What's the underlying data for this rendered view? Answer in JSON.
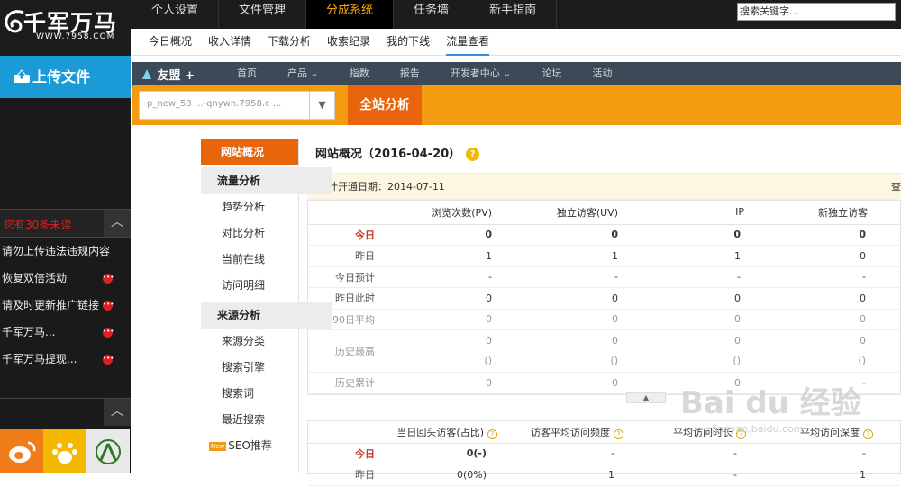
{
  "brand": {
    "name": "千军万马",
    "url": "WWW.7958.COM"
  },
  "top_nav": [
    "个人设置",
    "文件管理",
    "分成系统",
    "任务墙",
    "新手指南"
  ],
  "top_nav_active": "分成系统",
  "search": {
    "value": "搜索关键字..."
  },
  "sub_nav": [
    "今日概况",
    "收入详情",
    "下载分析",
    "收索纪录",
    "我的下线",
    "流量查看"
  ],
  "sub_nav_active": "流量查看",
  "sidebar": {
    "upload_label": "上传文件",
    "notice_title": "您有30条未读",
    "notices": [
      "请勿上传违法违规内容",
      "恢复双倍活动",
      "请及时更新推广链接",
      "千军万马...",
      "千军万马提现..."
    ],
    "social": [
      "weibo-icon",
      "baidu-paw-icon",
      "app-icon"
    ]
  },
  "umeng": {
    "logo": "友盟",
    "menu": [
      "首页",
      "产品 ⌄",
      "指数",
      "报告",
      "开发者中心 ⌄",
      "论坛",
      "活动"
    ],
    "site_select": "p_new_53 ...-qnywn.7958.c ...",
    "whole_site_label": "全站分析",
    "left_menu": {
      "active": "网站概况",
      "groups": [
        {
          "title": "流量分析",
          "items": [
            "趋势分析",
            "对比分析",
            "当前在线",
            "访问明细"
          ]
        },
        {
          "title": "来源分析",
          "items": [
            "来源分类",
            "搜索引擎",
            "搜索词",
            "最近搜索",
            "SEO推荐"
          ]
        }
      ],
      "new_badge": "New"
    },
    "overview_title": "网站概况（2016-04-20）",
    "help_icon": "?",
    "open_date": "统计开通日期：2014-07-11",
    "open_bar_right": "查",
    "table1": {
      "headers": [
        "",
        "浏览次数(PV)",
        "独立访客(UV)",
        "IP",
        "新独立访客"
      ],
      "rows": [
        {
          "label": "今日",
          "values": [
            "0",
            "0",
            "0",
            "0"
          ]
        },
        {
          "label": "昨日",
          "values": [
            "1",
            "1",
            "1",
            "0"
          ]
        },
        {
          "label": "今日预计",
          "values": [
            "-",
            "-",
            "-",
            "-"
          ]
        },
        {
          "label": "昨日此时",
          "values": [
            "0",
            "0",
            "0",
            "0"
          ]
        },
        {
          "label": "90日平均",
          "values": [
            "0",
            "0",
            "0",
            "0"
          ]
        },
        {
          "label": "历史最高",
          "values": [
            "0",
            "0",
            "0",
            "0"
          ],
          "sub": [
            "()",
            "()",
            "()",
            "()"
          ]
        },
        {
          "label": "历史累计",
          "values": [
            "0",
            "0",
            "0",
            "-"
          ]
        }
      ]
    },
    "table2": {
      "headers": [
        "",
        "当日回头访客(占比)",
        "访客平均访问频度",
        "平均访问时长",
        "平均访问深度"
      ],
      "rows": [
        {
          "label": "今日",
          "values": [
            "0(-)",
            "-",
            "-",
            "-"
          ]
        },
        {
          "label": "昨日",
          "values": [
            "0(0%)",
            "1",
            "-",
            "1"
          ]
        }
      ]
    }
  },
  "watermark": {
    "main": "Bai du 经验",
    "sub": "jingyan.baidu.com"
  },
  "colors": {
    "topbar": "#1c1c1c",
    "accent_orange": "#f39c12",
    "upload_blue": "#1a9bd7",
    "active_orange": "#e8650c"
  }
}
